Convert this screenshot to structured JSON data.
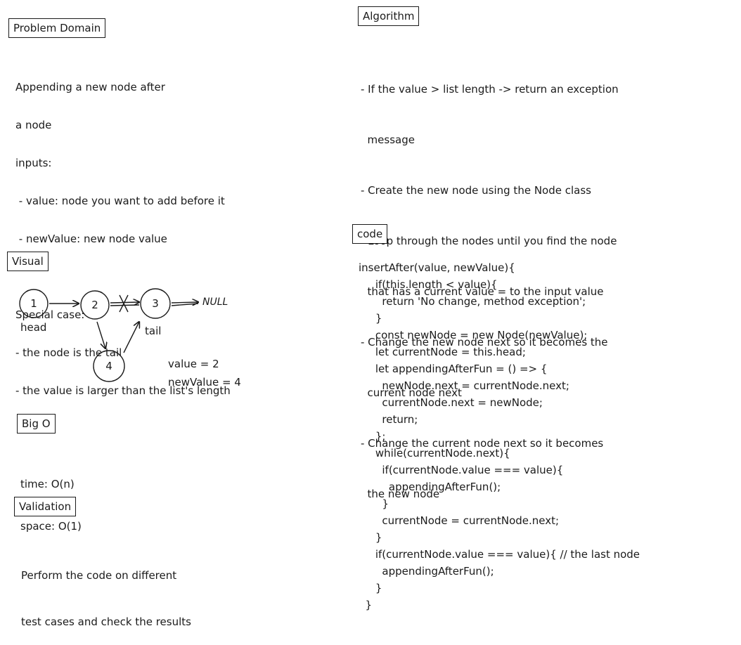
{
  "problem_domain": {
    "title": "Problem Domain",
    "lines": [
      "Appending a new node after",
      "a node",
      "inputs:",
      " - value: node you want to add before it",
      " - newValue: new node value",
      "",
      "Special case:",
      "- the node is the tail",
      "- the value is larger than the list's length"
    ]
  },
  "visual": {
    "title": "Visual",
    "nodes": [
      "1",
      "2",
      "3",
      "4"
    ],
    "head_label": "head",
    "tail_label": "tail",
    "null_label": "NULL",
    "value_line": "value = 2",
    "newvalue_line": "newValue = 4"
  },
  "big_o": {
    "title": "Big O",
    "lines": [
      "time: O(n)",
      "space: O(1)"
    ]
  },
  "validation": {
    "title": "Validation",
    "lines": [
      "Perform the code on different",
      "test cases and check the results"
    ]
  },
  "algorithm": {
    "title": "Algorithm",
    "lines": [
      "- If the value > list length -> return an exception",
      "  message",
      "- Create the new node using the Node class",
      "- Loop through the nodes until you find the node",
      "  that has a current value = to the input value",
      "- Change the new node next so it becomes the",
      "  current node next",
      "- Change the current node next so it becomes",
      "  the new node"
    ]
  },
  "code": {
    "title": "code",
    "lines": [
      "insertAfter(value, newValue){",
      "     if(this.length < value){",
      "       return 'No change, method exception';",
      "     }",
      "     const newNode = new Node(newValue);",
      "     let currentNode = this.head;",
      "     let appendingAfterFun = () => {",
      "       newNode.next = currentNode.next;",
      "       currentNode.next = newNode;",
      "       return;",
      "     };",
      "     while(currentNode.next){",
      "       if(currentNode.value === value){",
      "         appendingAfterFun();",
      "       }",
      "       currentNode = currentNode.next;",
      "     }",
      "     if(currentNode.value === value){ // the last node",
      "       appendingAfterFun();",
      "     }",
      "  }"
    ]
  }
}
